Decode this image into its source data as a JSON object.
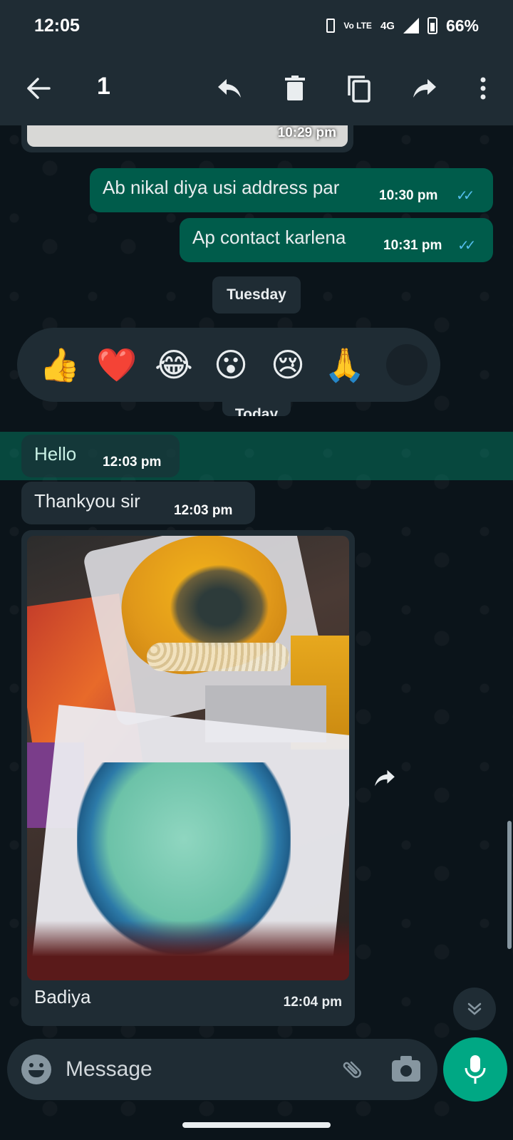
{
  "status_bar": {
    "time": "12:05",
    "volte": "Vo LTE",
    "network": "4G",
    "battery": "66%"
  },
  "action_bar": {
    "selected_count": "1",
    "icons": [
      "back-arrow-icon",
      "reply-icon",
      "delete-icon",
      "copy-icon",
      "forward-icon",
      "more-icon"
    ]
  },
  "messages": {
    "prev_image_time": "10:29 pm",
    "m1": {
      "text": "Ab nikal diya usi address par",
      "time": "10:30 pm"
    },
    "m2": {
      "text": "Ap contact karlena",
      "time": "10:31 pm"
    },
    "day_tuesday": "Tuesday",
    "day_today": "Today",
    "m3": {
      "text": "Hello",
      "time": "12:03 pm"
    },
    "m4": {
      "text": "Thankyou sir",
      "time": "12:03 pm"
    },
    "m5": {
      "caption": "Badiya",
      "time": "12:04 pm"
    }
  },
  "reactions": [
    "👍",
    "❤️",
    "😂",
    "😮",
    "😢",
    "🙏"
  ],
  "input": {
    "placeholder": "Message"
  },
  "colors": {
    "header": "#1f2c34",
    "background": "#0b141a",
    "outgoing_bubble": "#005c4b",
    "incoming_bubble": "#1f2c34",
    "accent": "#00a884",
    "read_ticks": "#53bdeb"
  }
}
